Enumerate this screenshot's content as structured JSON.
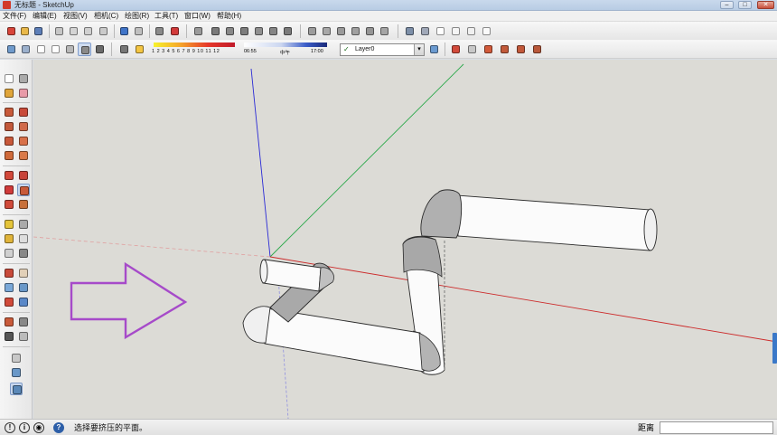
{
  "window": {
    "title": "无标题 - SketchUp",
    "controls": {
      "minimize": "–",
      "maximize": "□",
      "close": "✕"
    }
  },
  "menu": {
    "items": [
      "文件(F)",
      "编辑(E)",
      "视图(V)",
      "相机(C)",
      "绘图(R)",
      "工具(T)",
      "窗口(W)",
      "帮助(H)"
    ]
  },
  "toolbar": {
    "shadow_scale_ticks": "1 2 3 4 5 6 7 8 9 10 11 12",
    "time_start": "06:55",
    "time_mid": "中午",
    "time_end": "17:00",
    "layer": {
      "check": "✓",
      "name": "Layer0",
      "arrow": "▾"
    }
  },
  "colors": {
    "background_viewport": "#dcdbd6",
    "axis_blue": "#2a2ad6",
    "axis_green": "#2aa84a",
    "axis_red": "#cc2a2a",
    "arrow_outline": "#a64ac9",
    "pipe_fill": "#fbfbfb",
    "pipe_shade": "#a9a9a9"
  },
  "icons": {
    "titlebar": "sketchup-logo-icon",
    "status_left": [
      "info-circle-icon",
      "help-circle-icon",
      "user-circle-icon",
      "hint-icon"
    ]
  },
  "status": {
    "icon_labels": [
      "!",
      "i",
      "◉",
      "?"
    ],
    "message": "选择要挤压的平面。",
    "measure_label": "距离",
    "measure_value": ""
  }
}
